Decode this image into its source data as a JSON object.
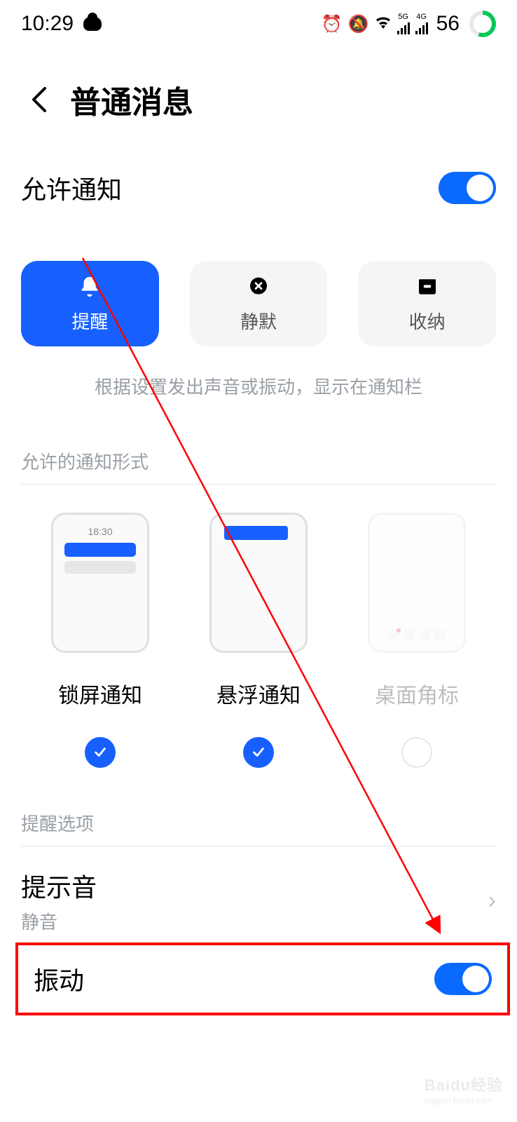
{
  "status": {
    "time": "10:29",
    "battery": "56",
    "sig1_label": "5G",
    "sig2_label": "4G"
  },
  "header": {
    "title": "普通消息"
  },
  "allow": {
    "label": "允许通知"
  },
  "modes": {
    "alert": "提醒",
    "silent": "静默",
    "store": "收纳",
    "desc": "根据设置发出声音或振动，显示在通知栏"
  },
  "forms": {
    "heading": "允许的通知形式",
    "lockscreen": "锁屏通知",
    "float": "悬浮通知",
    "badge": "桌面角标",
    "lock_time": "18:30"
  },
  "remind": {
    "heading": "提醒选项",
    "sound_title": "提示音",
    "sound_value": "静音",
    "vibrate": "振动"
  },
  "watermark": {
    "brand": "Baidu经验",
    "url": "jingyan.baidu.com"
  }
}
